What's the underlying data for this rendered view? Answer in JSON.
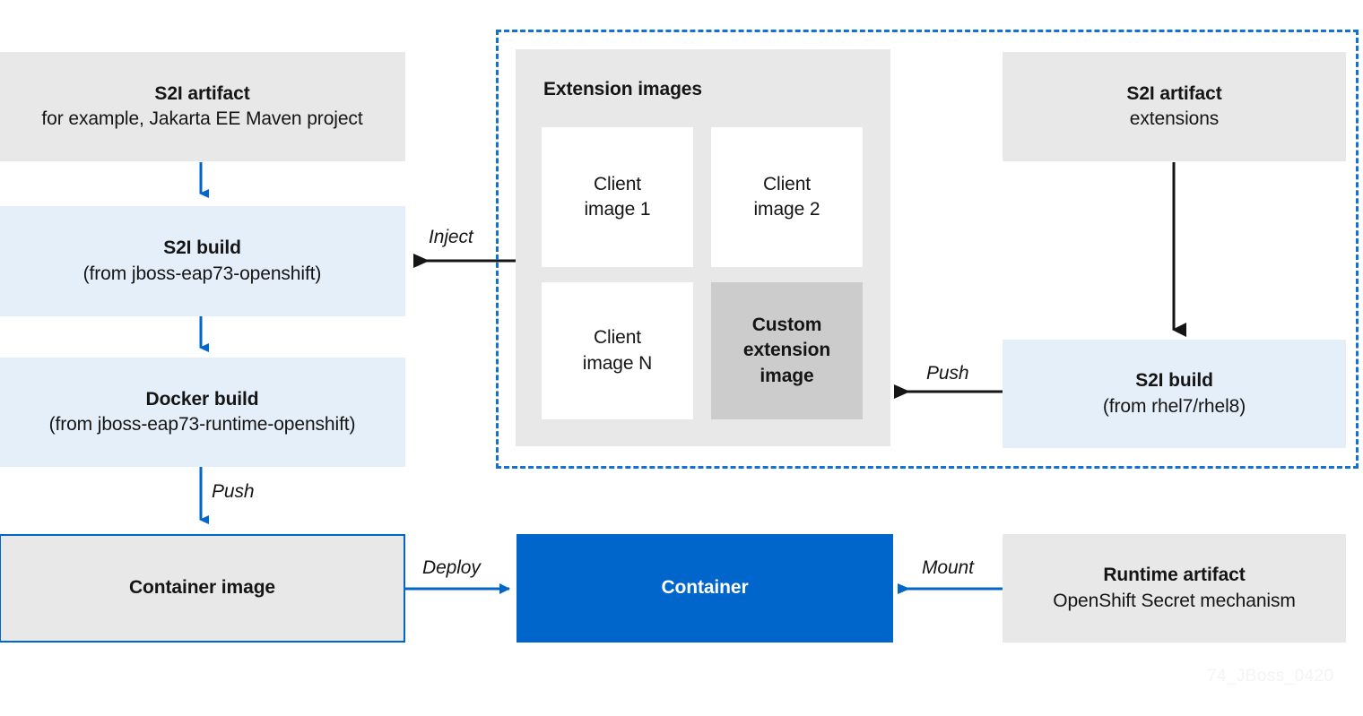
{
  "diagram": {
    "watermark": "74_JBoss_0420",
    "colors": {
      "accent_blue": "#0066CC",
      "dashed_border_blue": "#1471D4",
      "light_blue_fill": "#E4EFF9",
      "gray_fill": "#E8E8E8",
      "mid_gray_fill": "#CCCCCC",
      "white_fill": "#FFFFFF",
      "text_dark": "#151515",
      "arrow_black": "#151515"
    },
    "left_column": {
      "s2i_artifact": {
        "title": "S2I artifact",
        "subtitle": "for example, Jakarta EE Maven project"
      },
      "s2i_build": {
        "title": "S2I build",
        "subtitle": "(from jboss-eap73-openshift)"
      },
      "docker_build": {
        "title": "Docker build",
        "subtitle": "(from jboss-eap73-runtime-openshift)"
      },
      "container_image": {
        "title": "Container image",
        "subtitle": ""
      }
    },
    "extension_panel": {
      "title": "Extension images",
      "tiles": [
        {
          "line1": "Client",
          "line2": "image 1",
          "style": "white"
        },
        {
          "line1": "Client",
          "line2": "image 2",
          "style": "white"
        },
        {
          "line1": "Client",
          "line2": "image N",
          "style": "white"
        },
        {
          "line1": "Custom",
          "line2": "extension",
          "line3": "image",
          "style": "midgray"
        }
      ]
    },
    "right_column": {
      "s2i_artifact_extensions": {
        "title": "S2I artifact",
        "subtitle": "extensions"
      },
      "s2i_build_rhel": {
        "title": "S2I build",
        "subtitle": "(from rhel7/rhel8)"
      },
      "runtime_artifact": {
        "title": "Runtime artifact",
        "subtitle": "OpenShift Secret mechanism"
      }
    },
    "container": {
      "title": "Container"
    },
    "edge_labels": {
      "inject": "Inject",
      "push_left": "Push",
      "push_right": "Push",
      "deploy": "Deploy",
      "mount": "Mount"
    }
  }
}
